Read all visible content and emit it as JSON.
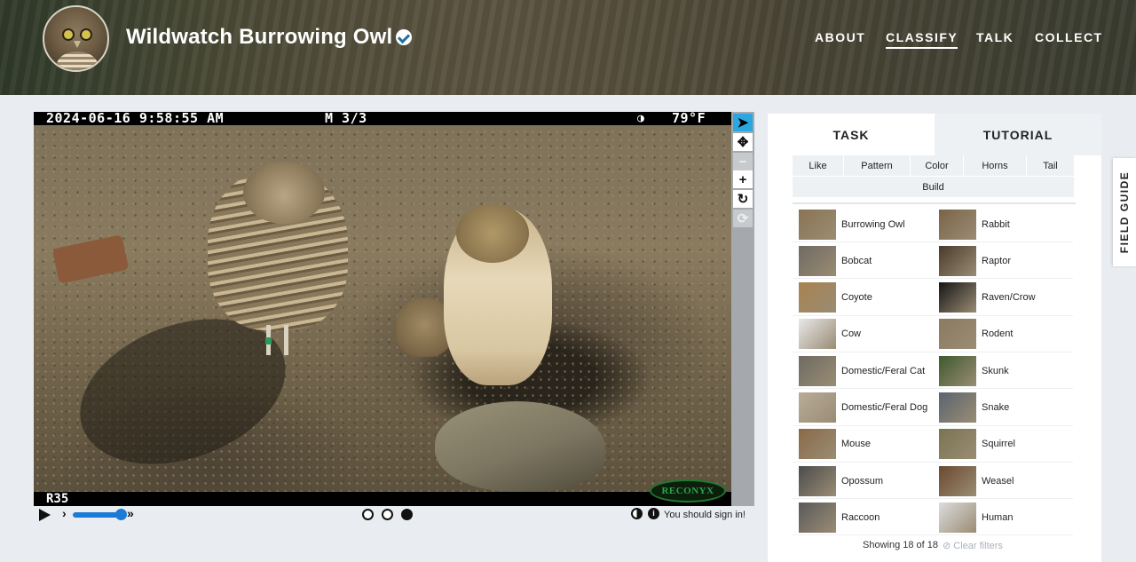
{
  "header": {
    "title": "Wildwatch Burrowing Owl",
    "nav": [
      "ABOUT",
      "CLASSIFY",
      "TALK",
      "COLLECT"
    ],
    "active_nav": "CLASSIFY"
  },
  "viewer": {
    "camera_timestamp": "2024-06-16 9:58:55 AM",
    "camera_mode": "M 3/3",
    "camera_temperature": "79°F",
    "camera_id": "R35",
    "camera_brand": "RECONYX",
    "tools": [
      "pointer-icon",
      "move-icon",
      "zoom-out-icon",
      "zoom-in-icon",
      "rotate-icon",
      "reset-icon"
    ],
    "frames_total": 3,
    "current_frame": 3,
    "sign_in_message": "You should sign in!"
  },
  "task_panel": {
    "tabs": [
      "TASK",
      "TUTORIAL"
    ],
    "active_tab": "TASK",
    "filters": [
      "Like",
      "Pattern",
      "Color",
      "Horns",
      "Tail",
      "Build"
    ],
    "choices": [
      {
        "label": "Burrowing Owl",
        "color": "#8a7452"
      },
      {
        "label": "Rabbit",
        "color": "#7a6448"
      },
      {
        "label": "Bobcat",
        "color": "#6f6a62"
      },
      {
        "label": "Raptor",
        "color": "#4a3a2c"
      },
      {
        "label": "Coyote",
        "color": "#a8824e"
      },
      {
        "label": "Raven/Crow",
        "color": "#161616"
      },
      {
        "label": "Cow",
        "color": "#e8e8e8"
      },
      {
        "label": "Rodent",
        "color": "#8c7a62"
      },
      {
        "label": "Domestic/Feral Cat",
        "color": "#6d6b62"
      },
      {
        "label": "Skunk",
        "color": "#3e5a2e"
      },
      {
        "label": "Domestic/Feral Dog",
        "color": "#b8ac98"
      },
      {
        "label": "Snake",
        "color": "#5a6470"
      },
      {
        "label": "Mouse",
        "color": "#8a6a48"
      },
      {
        "label": "Squirrel",
        "color": "#7a7452"
      },
      {
        "label": "Opossum",
        "color": "#4c4c4c"
      },
      {
        "label": "Weasel",
        "color": "#6a4a30"
      },
      {
        "label": "Raccoon",
        "color": "#5a5a5a"
      },
      {
        "label": "Human",
        "color": "#dcdcdc"
      }
    ],
    "showing_text": "Showing 18 of 18",
    "clear_filters": "Clear filters"
  },
  "field_guide": "FIELD GUIDE"
}
